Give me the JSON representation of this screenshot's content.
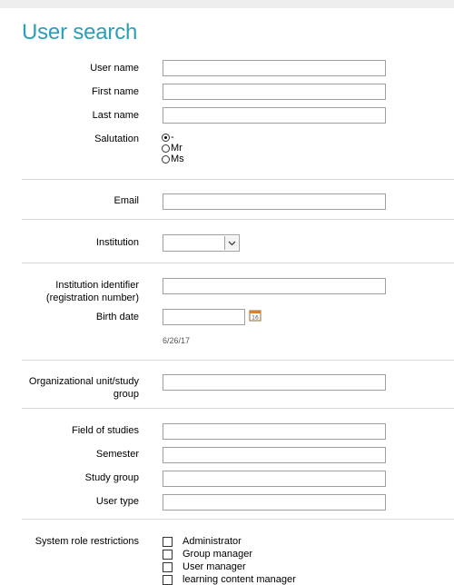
{
  "page": {
    "title": "User search"
  },
  "fields": {
    "username": {
      "label": "User name",
      "value": ""
    },
    "first_name": {
      "label": "First name",
      "value": ""
    },
    "last_name": {
      "label": "Last name",
      "value": ""
    },
    "salutation": {
      "label": "Salutation",
      "options": [
        "-",
        "Mr",
        "Ms"
      ],
      "selected": "-"
    },
    "email": {
      "label": "Email",
      "value": ""
    },
    "institution": {
      "label": "Institution",
      "value": ""
    },
    "institution_identifier": {
      "label_line1": "Institution identifier",
      "label_line2": "(registration number)",
      "value": ""
    },
    "birth_date": {
      "label": "Birth date",
      "value": "",
      "format_hint": "6/26/17"
    },
    "org_unit": {
      "label_line1": "Organizational unit/study",
      "label_line2": "group",
      "value": ""
    },
    "field_of_studies": {
      "label": "Field of studies",
      "value": ""
    },
    "semester": {
      "label": "Semester",
      "value": ""
    },
    "study_group": {
      "label": "Study group",
      "value": ""
    },
    "user_type": {
      "label": "User type",
      "value": ""
    },
    "system_roles": {
      "label": "System role restrictions",
      "options": [
        "Administrator",
        "Group manager",
        "User manager",
        "learning content manager"
      ]
    }
  },
  "icons": {
    "calendar": "calendar-icon",
    "dropdown": "chevron-down-icon"
  },
  "colors": {
    "title": "#2a9fb7",
    "divider": "#d8d8d8",
    "input_border": "#a0a0a0"
  }
}
